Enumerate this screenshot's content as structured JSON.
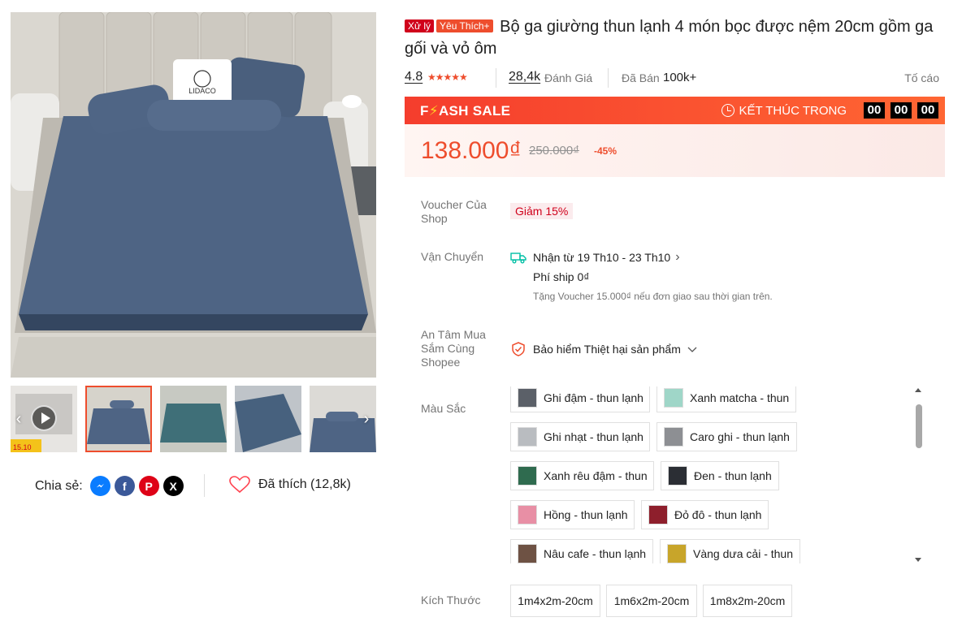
{
  "gallery": {
    "main_logo_text": "LIDACO",
    "thumb_label_1": "15.10"
  },
  "share": {
    "label": "Chia sẻ:"
  },
  "like": {
    "label": "Đã thích (12,8k)"
  },
  "product": {
    "badge_mall": "Xử lý",
    "badge_fav": "Yêu Thích+",
    "title": "Bộ ga giường thun lạnh 4 món bọc được nệm 20cm gồm ga gối và vỏ ôm",
    "rating": "4.8",
    "stars": "★★★★★",
    "reviews_count": "28,4k",
    "reviews_label": "Đánh Giá",
    "sold_label": "Đã Bán",
    "sold_count": "100k+",
    "report": "Tố cáo"
  },
  "flash_sale": {
    "logo_pre": "F",
    "logo_bolt": "⚡",
    "logo_post": "ASH SALE",
    "ends_label": "KẾT THÚC TRONG",
    "hours": "00",
    "minutes": "00",
    "seconds": "00",
    "price": "138.000₫",
    "old_price": "250.000₫",
    "discount": "-45%"
  },
  "voucher": {
    "label": "Voucher Của Shop",
    "tag": "Giảm 15%"
  },
  "shipping": {
    "label": "Vận Chuyển",
    "delivery": "Nhận từ 19 Th10 - 23 Th10",
    "fee": "Phí ship 0₫",
    "note": "Tặng Voucher 15.000₫ nếu đơn giao sau thời gian trên."
  },
  "assurance": {
    "label": "An Tâm Mua Sắm Cùng Shopee",
    "value": "Bảo hiểm Thiệt hại sản phẩm"
  },
  "color": {
    "label": "Màu Sắc",
    "options": [
      {
        "label": "Ghi đậm - thun lạnh",
        "swatch": "#5b6068"
      },
      {
        "label": "Xanh matcha - thun",
        "swatch": "#9fd6c8"
      },
      {
        "label": "Ghi nhạt - thun lạnh",
        "swatch": "#b9bcc0"
      },
      {
        "label": "Caro ghi - thun lạnh",
        "swatch": "#8d8f93"
      },
      {
        "label": "Xanh rêu đậm - thun",
        "swatch": "#2f6b4f"
      },
      {
        "label": "Đen - thun lạnh",
        "swatch": "#2b2e34"
      },
      {
        "label": "Hồng - thun lạnh",
        "swatch": "#e88fa5"
      },
      {
        "label": "Đỏ đô - thun lạnh",
        "swatch": "#8e1f2c"
      },
      {
        "label": "Nâu cafe - thun lạnh",
        "swatch": "#6e5244"
      },
      {
        "label": "Vàng dưa cải - thun",
        "swatch": "#c8a52a"
      }
    ]
  },
  "size": {
    "label": "Kích Thước",
    "options": [
      "1m4x2m-20cm",
      "1m6x2m-20cm",
      "1m8x2m-20cm"
    ]
  }
}
